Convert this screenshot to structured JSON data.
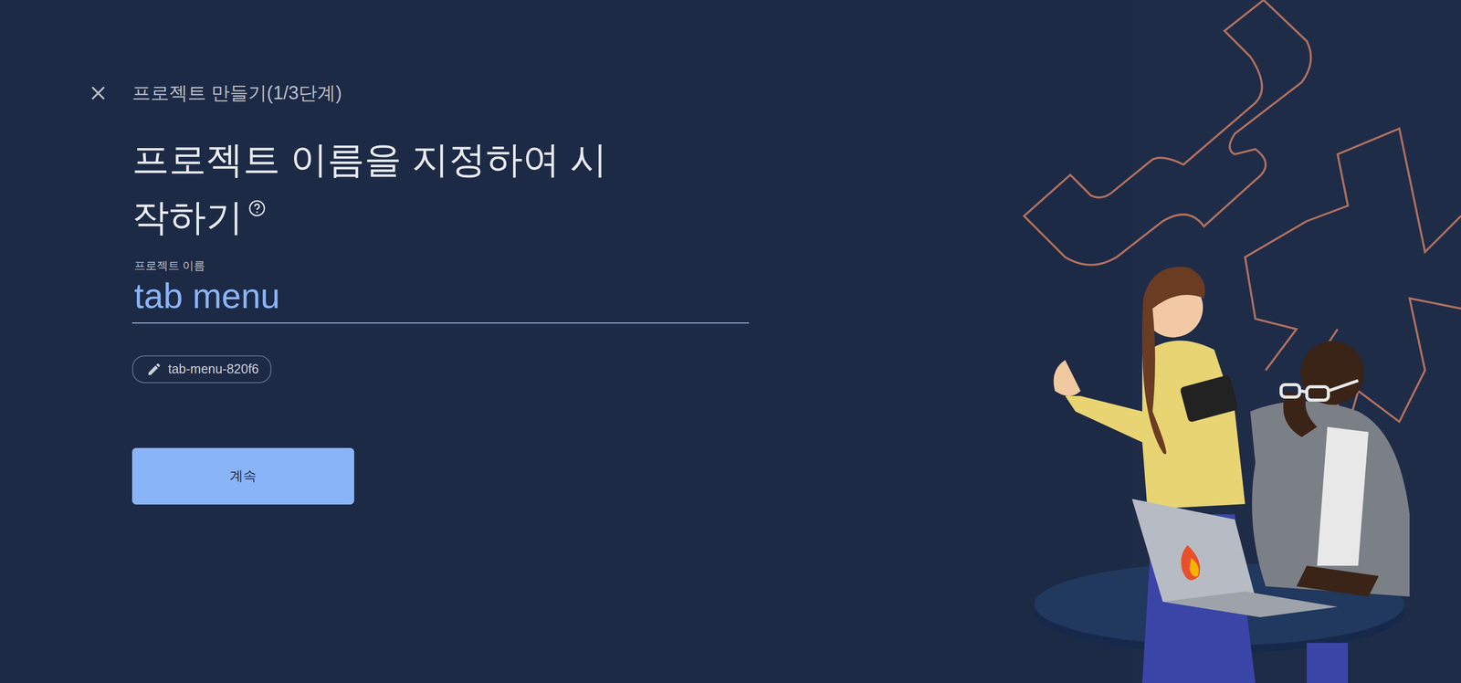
{
  "header": {
    "title": "프로젝트 만들기(1/3단계)"
  },
  "heading": "프로젝트 이름을 지정하여 시작하기",
  "field": {
    "label": "프로젝트 이름",
    "value": "tab menu"
  },
  "project_id": "tab-menu-820f6",
  "buttons": [
    "계속"
  ]
}
